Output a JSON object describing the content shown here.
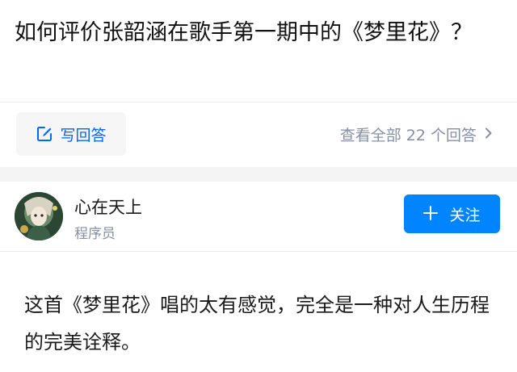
{
  "question": {
    "title": "如何评价张韶涵在歌手第一期中的《梦里花》？"
  },
  "actions": {
    "write_answer_label": "写回答",
    "view_all_label": "查看全部 22 个回答"
  },
  "author": {
    "name": "心在天上",
    "title": "程序员"
  },
  "follow": {
    "label": "关注"
  },
  "answer": {
    "text": "这首《梦里花》唱的太有感觉，完全是一种对人生历程的完美诠释。"
  },
  "colors": {
    "accent": "#0084ff",
    "link_blue": "#0066ff",
    "muted": "#8590a6"
  },
  "icons": {
    "write": "pencil-square-icon",
    "chevron": "chevron-right-icon",
    "plus": "plus-icon"
  }
}
